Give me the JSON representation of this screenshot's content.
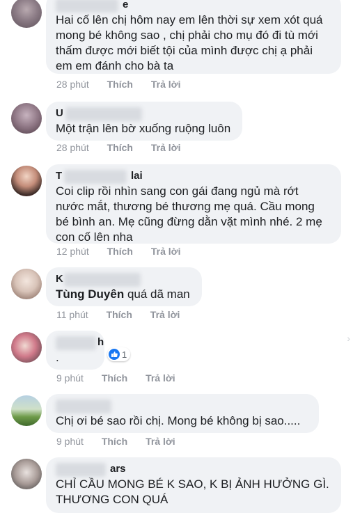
{
  "colors": {
    "bubble": "#f0f2f5",
    "meta": "#90949c",
    "like": "#1877f2"
  },
  "comments": [
    {
      "name_suffix": "e",
      "text": "Hai cố lên chị hôm nay em lên thời sự xem xót quá\nmong bé không sao , chị phải cho mụ đó đi tù mới\nthấm được mới biết tội của mình được chị ạ phải\nem em đánh cho bà ta",
      "time": "28 phút",
      "like": "Thích",
      "reply": "Trả lời"
    },
    {
      "name_suffix": "U",
      "text": "Một trận lên bờ xuống ruộng luôn",
      "time": "28 phút",
      "like": "Thích",
      "reply": "Trả lời"
    },
    {
      "name_prefix": "T",
      "name_suffix": "lai",
      "text": "Coi clip rồi nhìn sang con gái đang ngủ mà rớt\nnước mắt, thương bé thương mẹ quá. Cầu mong\nbé bình an. Mẹ cũng đừng dằn vặt mình nhé. 2 mẹ\ncon cố lên nha",
      "time": "12 phút",
      "like": "Thích",
      "reply": "Trả lời"
    },
    {
      "name_prefix": "K",
      "mention": "Tùng Duyên",
      "text": "quá dã man",
      "time": "11 phút",
      "like": "Thích",
      "reply": "Trả lời"
    },
    {
      "name_suffix": "h",
      "text": ".",
      "reaction_count": "1",
      "time": "9 phút",
      "like": "Thích",
      "reply": "Trả lời"
    },
    {
      "text": "Chị ơi bé sao rồi chị. Mong bé không bị sao.....",
      "time": "9 phút",
      "like": "Thích",
      "reply": "Trả lời"
    },
    {
      "name_suffix": "ars",
      "text": "CHỈ CẦU MONG BÉ K SAO, K BỊ ẢNH HƯỞNG GÌ.\nTHƯƠNG CON QUÁ"
    }
  ]
}
